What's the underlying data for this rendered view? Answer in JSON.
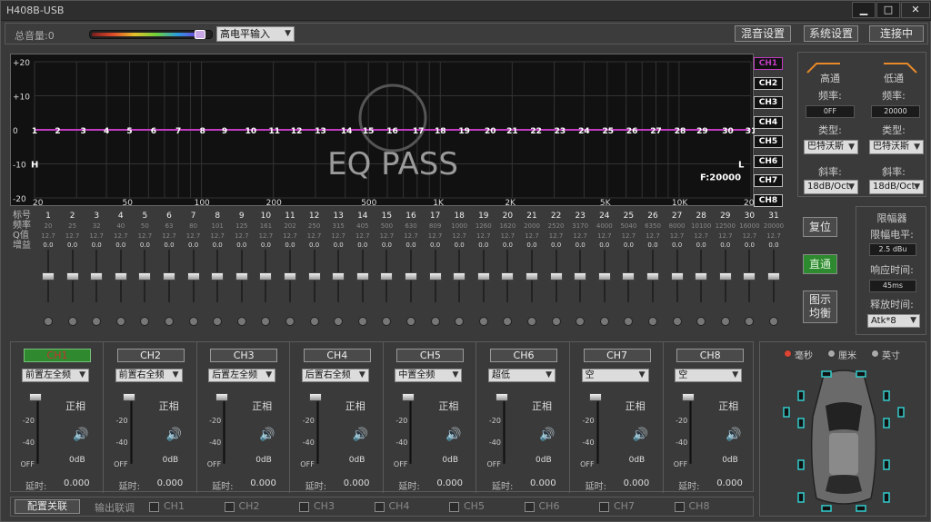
{
  "app": {
    "title": "H408B-USB",
    "win_buttons": [
      "▁",
      "□",
      "✕"
    ]
  },
  "toolbar": {
    "volume_label": "总音量:0",
    "volume_level": 0.92,
    "input_mode": "高电平输入",
    "mix_btn": "混音设置",
    "sys_btn": "系统设置",
    "connect_btn": "连接中"
  },
  "graph": {
    "y_ticks": [
      "+20",
      "+10",
      "0",
      "-10",
      "-20"
    ],
    "x_ticks": [
      "20",
      "50",
      "100",
      "200",
      "500",
      "1K",
      "2K",
      "5K",
      "10K",
      "20K"
    ],
    "watermark": "EQ PASS",
    "h_label": "H",
    "l_label": "L",
    "freq_label": "F:20000",
    "band_markers": [
      "1",
      "2",
      "3",
      "4",
      "5",
      "6",
      "7",
      "8",
      "9",
      "10",
      "11",
      "12",
      "13",
      "14",
      "15",
      "16",
      "17",
      "18",
      "19",
      "20",
      "21",
      "22",
      "23",
      "24",
      "25",
      "26",
      "27",
      "28",
      "29",
      "30",
      "31"
    ],
    "channels": [
      "CH1",
      "CH2",
      "CH3",
      "CH4",
      "CH5",
      "CH6",
      "CH7",
      "CH8"
    ],
    "active_channel": "CH1",
    "curve_color": "#c23cc2"
  },
  "filters": {
    "hp": {
      "title": "高通",
      "freq_label": "频率:",
      "freq": "0FF",
      "type_label": "类型:",
      "type": "巴特沃斯",
      "slope_label": "斜率:",
      "slope": "18dB/Oct"
    },
    "lp": {
      "title": "低通",
      "freq_label": "频率:",
      "freq": "20000",
      "type_label": "类型:",
      "type": "巴特沃斯",
      "slope_label": "斜率:",
      "slope": "18dB/Oct"
    }
  },
  "buttons": {
    "reset": "复位",
    "direct": "直通",
    "graph_eq": "图示\n均衡"
  },
  "limiter": {
    "title": "限幅器",
    "level_label": "限幅电平:",
    "level": "2.5 dBu",
    "attack_label": "响应时间:",
    "attack": "45ms",
    "release_label": "释放时间:",
    "release": "Atk*8"
  },
  "band_labels": [
    "标号",
    "频率",
    "Q值",
    "增益"
  ],
  "bands": [
    {
      "n": "1",
      "f": "20",
      "q": "12.7",
      "g": "0.0"
    },
    {
      "n": "2",
      "f": "25",
      "q": "12.7",
      "g": "0.0"
    },
    {
      "n": "3",
      "f": "32",
      "q": "12.7",
      "g": "0.0"
    },
    {
      "n": "4",
      "f": "40",
      "q": "12.7",
      "g": "0.0"
    },
    {
      "n": "5",
      "f": "50",
      "q": "12.7",
      "g": "0.0"
    },
    {
      "n": "6",
      "f": "63",
      "q": "12.7",
      "g": "0.0"
    },
    {
      "n": "7",
      "f": "80",
      "q": "12.7",
      "g": "0.0"
    },
    {
      "n": "8",
      "f": "101",
      "q": "12.7",
      "g": "0.0"
    },
    {
      "n": "9",
      "f": "125",
      "q": "12.7",
      "g": "0.0"
    },
    {
      "n": "10",
      "f": "161",
      "q": "12.7",
      "g": "0.0"
    },
    {
      "n": "11",
      "f": "202",
      "q": "12.7",
      "g": "0.0"
    },
    {
      "n": "12",
      "f": "250",
      "q": "12.7",
      "g": "0.0"
    },
    {
      "n": "13",
      "f": "315",
      "q": "12.7",
      "g": "0.0"
    },
    {
      "n": "14",
      "f": "405",
      "q": "12.7",
      "g": "0.0"
    },
    {
      "n": "15",
      "f": "500",
      "q": "12.7",
      "g": "0.0"
    },
    {
      "n": "16",
      "f": "630",
      "q": "12.7",
      "g": "0.0"
    },
    {
      "n": "17",
      "f": "809",
      "q": "12.7",
      "g": "0.0"
    },
    {
      "n": "18",
      "f": "1000",
      "q": "12.7",
      "g": "0.0"
    },
    {
      "n": "19",
      "f": "1260",
      "q": "12.7",
      "g": "0.0"
    },
    {
      "n": "20",
      "f": "1620",
      "q": "12.7",
      "g": "0.0"
    },
    {
      "n": "21",
      "f": "2000",
      "q": "12.7",
      "g": "0.0"
    },
    {
      "n": "22",
      "f": "2520",
      "q": "12.7",
      "g": "0.0"
    },
    {
      "n": "23",
      "f": "3170",
      "q": "12.7",
      "g": "0.0"
    },
    {
      "n": "24",
      "f": "4000",
      "q": "12.7",
      "g": "0.0"
    },
    {
      "n": "25",
      "f": "5040",
      "q": "12.7",
      "g": "0.0"
    },
    {
      "n": "26",
      "f": "6350",
      "q": "12.7",
      "g": "0.0"
    },
    {
      "n": "27",
      "f": "8000",
      "q": "12.7",
      "g": "0.0"
    },
    {
      "n": "28",
      "f": "10100",
      "q": "12.7",
      "g": "0.0"
    },
    {
      "n": "29",
      "f": "12500",
      "q": "12.7",
      "g": "0.0"
    },
    {
      "n": "30",
      "f": "16000",
      "q": "12.7",
      "g": "0.0"
    },
    {
      "n": "31",
      "f": "20000",
      "q": "12.7",
      "g": "0.0"
    }
  ],
  "outputs": [
    {
      "name": "CH1",
      "pos": "前置左全频",
      "active": true
    },
    {
      "name": "CH2",
      "pos": "前置右全频",
      "active": false
    },
    {
      "name": "CH3",
      "pos": "后置左全频",
      "active": false
    },
    {
      "name": "CH4",
      "pos": "后置右全频",
      "active": false
    },
    {
      "name": "CH5",
      "pos": "中置全频",
      "active": false
    },
    {
      "name": "CH6",
      "pos": "超低",
      "active": false
    },
    {
      "name": "CH7",
      "pos": "空",
      "active": false
    },
    {
      "name": "CH8",
      "pos": "空",
      "active": false
    }
  ],
  "output_common": {
    "phase": "正相",
    "db": "0dB",
    "delay_label": "延时:",
    "delay": "0.000",
    "scale": [
      "0",
      "-20",
      "-40",
      "OFF"
    ]
  },
  "bottom": {
    "lock_btn": "配置关联",
    "link_label": "输出联调",
    "link_channels": [
      "CH1",
      "CH2",
      "CH3",
      "CH4",
      "CH5",
      "CH6",
      "CH7",
      "CH8"
    ]
  },
  "car": {
    "units": [
      "毫秒",
      "厘米",
      "英寸"
    ],
    "selected_unit": "毫秒"
  }
}
